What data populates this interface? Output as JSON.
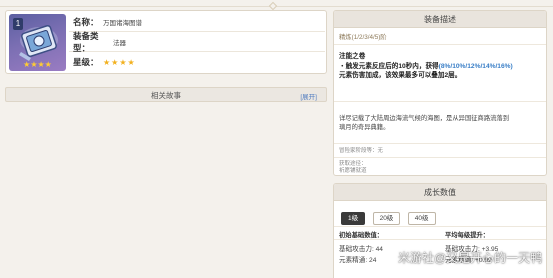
{
  "item": {
    "badge": "1",
    "icon_stars": "★★★★",
    "name_label": "名称：",
    "name_value": "万国诸海图谱",
    "type_label": "装备类型：",
    "type_value": "法器",
    "rarity_label": "星级：",
    "rarity_stars": "★★★★",
    "rarity": 4
  },
  "story": {
    "title": "相关故事",
    "expand_label": "[展开]"
  },
  "description": {
    "title": "装备描述",
    "refine_text": "精炼(1/2/3/4/5)阶",
    "effect_name": "注能之卷",
    "effect_line1_prefix": "・触发元素反应后的10秒内，获得",
    "effect_line1_values": "(8%/10%/12%/14%/16%)",
    "effect_line2": "元素伤害加成，该效果最多可以叠加2层。",
    "lore_line1": "详尽记载了大陆周边海流气候的海图，是从异国征商路流落到",
    "lore_line2": "璃月的奇异典籍。",
    "ascend_text": "冒险家阶段等：无",
    "source_label": "获取途径：",
    "source_value": "祈愿铺就道"
  },
  "growth": {
    "title": "成长数值",
    "levels": [
      "1级",
      "20级",
      "40级"
    ],
    "active_level": "1级",
    "base_header": "初始基础数值：",
    "avg_header": "平均每级提升：",
    "base_atk": "基础攻击力: 44",
    "base_em": "元素精通: 24",
    "avg_atk": "基础攻击力: +3.95",
    "avg_em": "元素精通: +0.99"
  },
  "watermark": "米游社@又是开心的一天鸭",
  "colors": {
    "accent_blue": "#3a7fc7",
    "star_gold": "#f2b01e",
    "active_button": "#3a3a3a"
  }
}
